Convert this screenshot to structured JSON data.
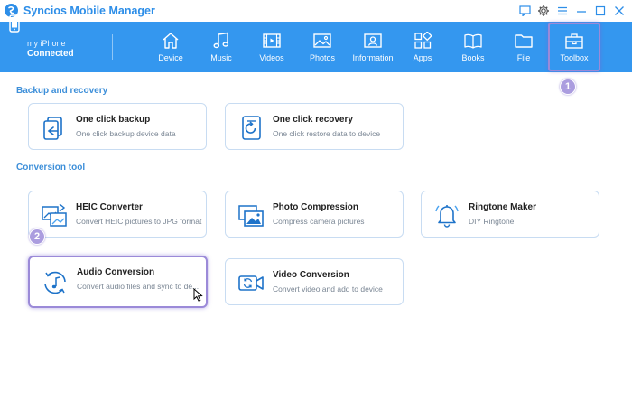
{
  "app": {
    "title": "Syncios Mobile Manager"
  },
  "device": {
    "name": "my iPhone",
    "status": "Connected"
  },
  "nav": [
    {
      "key": "device",
      "label": "Device",
      "icon": "home-icon"
    },
    {
      "key": "music",
      "label": "Music",
      "icon": "music-note-icon"
    },
    {
      "key": "videos",
      "label": "Videos",
      "icon": "film-icon"
    },
    {
      "key": "photos",
      "label": "Photos",
      "icon": "image-icon"
    },
    {
      "key": "information",
      "label": "Information",
      "icon": "contact-card-icon"
    },
    {
      "key": "apps",
      "label": "Apps",
      "icon": "apps-grid-icon"
    },
    {
      "key": "books",
      "label": "Books",
      "icon": "book-icon"
    },
    {
      "key": "file",
      "label": "File",
      "icon": "folder-icon"
    },
    {
      "key": "toolbox",
      "label": "Toolbox",
      "icon": "toolbox-icon",
      "selected": true
    }
  ],
  "steps": {
    "one": "1",
    "two": "2"
  },
  "sections": {
    "backup": {
      "title": "Backup and recovery",
      "cards": [
        {
          "title": "One click backup",
          "desc": "One click backup device data",
          "icon": "backup-icon"
        },
        {
          "title": "One click recovery",
          "desc": "One click restore data to device",
          "icon": "recovery-icon"
        }
      ]
    },
    "conversion": {
      "title": "Conversion tool",
      "cards": [
        {
          "title": "HEIC Converter",
          "desc": "Convert HEIC pictures to JPG format",
          "icon": "heic-convert-icon"
        },
        {
          "title": "Photo Compression",
          "desc": "Compress camera pictures",
          "icon": "photo-compress-icon"
        },
        {
          "title": "Ringtone Maker",
          "desc": "DIY Ringtone",
          "icon": "bell-icon"
        },
        {
          "title": "Audio Conversion",
          "desc": "Convert audio files and sync to de...",
          "icon": "audio-convert-icon",
          "highlighted": true
        },
        {
          "title": "Video Conversion",
          "desc": "Convert video and add to device",
          "icon": "video-convert-icon"
        }
      ]
    }
  },
  "colors": {
    "accent": "#3497ef",
    "highlight": "#9b8ad8",
    "section_title": "#3d8fd9"
  }
}
